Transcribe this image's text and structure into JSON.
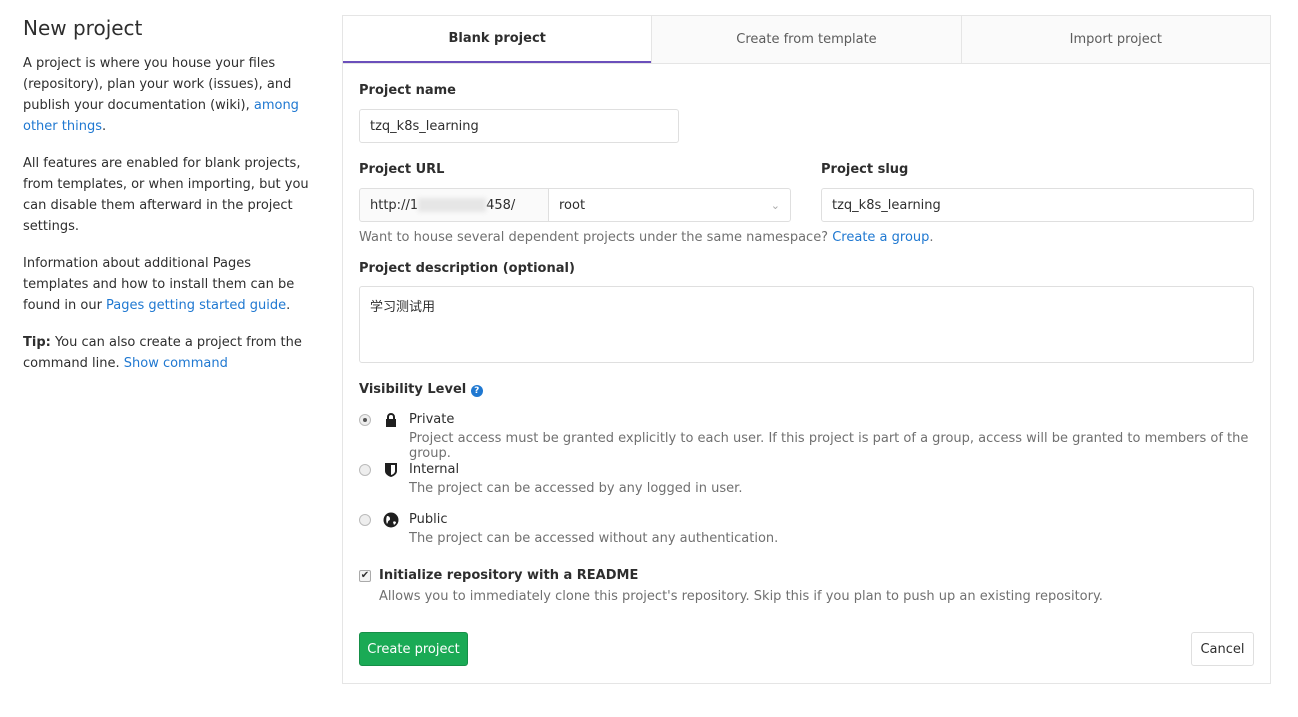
{
  "sidebar": {
    "title": "New project",
    "p1_text": "A project is where you house your files (repository), plan your work (issues), and publish your documentation (wiki), ",
    "p1_link": "among other things",
    "p1_end": ".",
    "p2": "All features are enabled for blank projects, from templates, or when importing, but you can disable them afterward in the project settings.",
    "p3_text": "Information about additional Pages templates and how to install them can be found in our ",
    "p3_link": "Pages getting started guide",
    "p3_end": ".",
    "tip_label": "Tip:",
    "tip_text": " You can also create a project from the command line. ",
    "tip_link": "Show command"
  },
  "tabs": [
    {
      "label": "Blank project",
      "active": true
    },
    {
      "label": "Create from template"
    },
    {
      "label": "Import project"
    }
  ],
  "form": {
    "name_label": "Project name",
    "name_value": "tzq_k8s_learning",
    "url_label": "Project URL",
    "url_prefix_start": "http://1",
    "url_prefix_end": "458/",
    "namespace": "root",
    "slug_label": "Project slug",
    "slug_value": "tzq_k8s_learning",
    "group_help": "Want to house several dependent projects under the same namespace? ",
    "group_link": "Create a group",
    "group_end": ".",
    "desc_label": "Project description (optional)",
    "desc_value": "学习测试用",
    "visibility_label": "Visibility Level",
    "visibility": [
      {
        "title": "Private",
        "desc": "Project access must be granted explicitly to each user. If this project is part of a group, access will be granted to members of the group.",
        "icon": "lock-icon",
        "selected": true
      },
      {
        "title": "Internal",
        "desc": "The project can be accessed by any logged in user.",
        "icon": "shield-icon",
        "selected": false
      },
      {
        "title": "Public",
        "desc": "The project can be accessed without any authentication.",
        "icon": "globe-icon",
        "selected": false
      }
    ],
    "readme_label": "Initialize repository with a README",
    "readme_checked": true,
    "readme_desc": "Allows you to immediately clone this project's repository. Skip this if you plan to push up an existing repository.",
    "create_label": "Create project",
    "cancel_label": "Cancel"
  },
  "colors": {
    "accent": "#6b4fbb",
    "link": "#1f78d1",
    "create": "#1aaa55"
  }
}
